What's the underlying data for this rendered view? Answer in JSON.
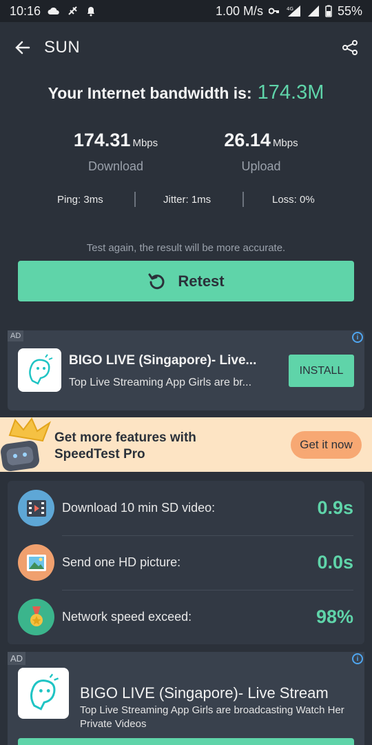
{
  "status_bar": {
    "time": "10:16",
    "net_speed": "1.00 M/s",
    "network_type": "4G",
    "battery": "55%"
  },
  "header": {
    "title": "SUN",
    "back_icon": "arrow-left-icon",
    "share_icon": "share-icon"
  },
  "result": {
    "bandwidth_label": "Your Internet bandwidth is:",
    "bandwidth_value": "174.3M",
    "download_value": "174.31",
    "download_unit": "Mbps",
    "download_label": "Download",
    "upload_value": "26.14",
    "upload_unit": "Mbps",
    "upload_label": "Upload",
    "ping": "Ping: 3ms",
    "jitter": "Jitter: 1ms",
    "loss": "Loss: 0%",
    "hint": "Test again, the result will be more accurate.",
    "retest_label": "Retest"
  },
  "ad_top": {
    "tag": "AD",
    "title": "BIGO LIVE (Singapore)- Live...",
    "description": "Top Live Streaming App Girls are br...",
    "install_label": "INSTALL"
  },
  "promo": {
    "line1": "Get more features with",
    "line2": "SpeedTest Pro",
    "button_label": "Get it now"
  },
  "stats": [
    {
      "label": "Download 10 min SD video:",
      "value": "0.9s",
      "icon": "film-icon",
      "color": "#5ea7d6"
    },
    {
      "label": "Send one HD picture:",
      "value": "0.0s",
      "icon": "picture-icon",
      "color": "#f0a06e"
    },
    {
      "label": "Network speed exceed:",
      "value": "98%",
      "icon": "medal-icon",
      "color": "#3bb58c"
    }
  ],
  "ad_bottom": {
    "tag": "AD",
    "title": "BIGO LIVE (Singapore)- Live Stream",
    "description": "Top Live Streaming App Girls are broadcasting Watch Her Private Videos"
  },
  "colors": {
    "accent": "#5fd4a9",
    "background": "#2b313a",
    "promo_background": "#fde4c4",
    "promo_button": "#f7a873"
  }
}
